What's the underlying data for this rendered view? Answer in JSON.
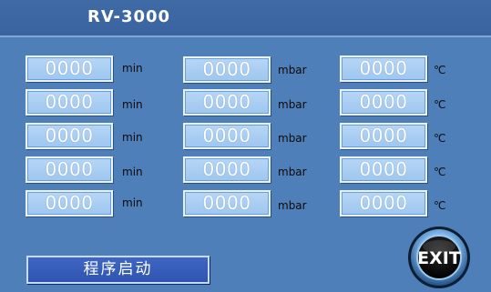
{
  "header": {
    "title": "RV-3000"
  },
  "rows": [
    {
      "time": "0000",
      "time_unit": "min",
      "pressure": "0000",
      "pressure_unit": "mbar",
      "temp": "0000",
      "temp_unit": "℃"
    },
    {
      "time": "0000",
      "time_unit": "min",
      "pressure": "0000",
      "pressure_unit": "mbar",
      "temp": "0000",
      "temp_unit": "℃"
    },
    {
      "time": "0000",
      "time_unit": "min",
      "pressure": "0000",
      "pressure_unit": "mbar",
      "temp": "0000",
      "temp_unit": "℃"
    },
    {
      "time": "0000",
      "time_unit": "min",
      "pressure": "0000",
      "pressure_unit": "mbar",
      "temp": "0000",
      "temp_unit": "℃"
    },
    {
      "time": "0000",
      "time_unit": "min",
      "pressure": "0000",
      "pressure_unit": "mbar",
      "temp": "0000",
      "temp_unit": "℃"
    }
  ],
  "footer": {
    "start_label": "程序启动",
    "exit_label": "EXIT",
    "exit_icon": "exit-circle-icon"
  },
  "colors": {
    "background": "#4f7fb8",
    "field_fill": "#a9cdf3",
    "button_fill": "#3a5fbf"
  }
}
